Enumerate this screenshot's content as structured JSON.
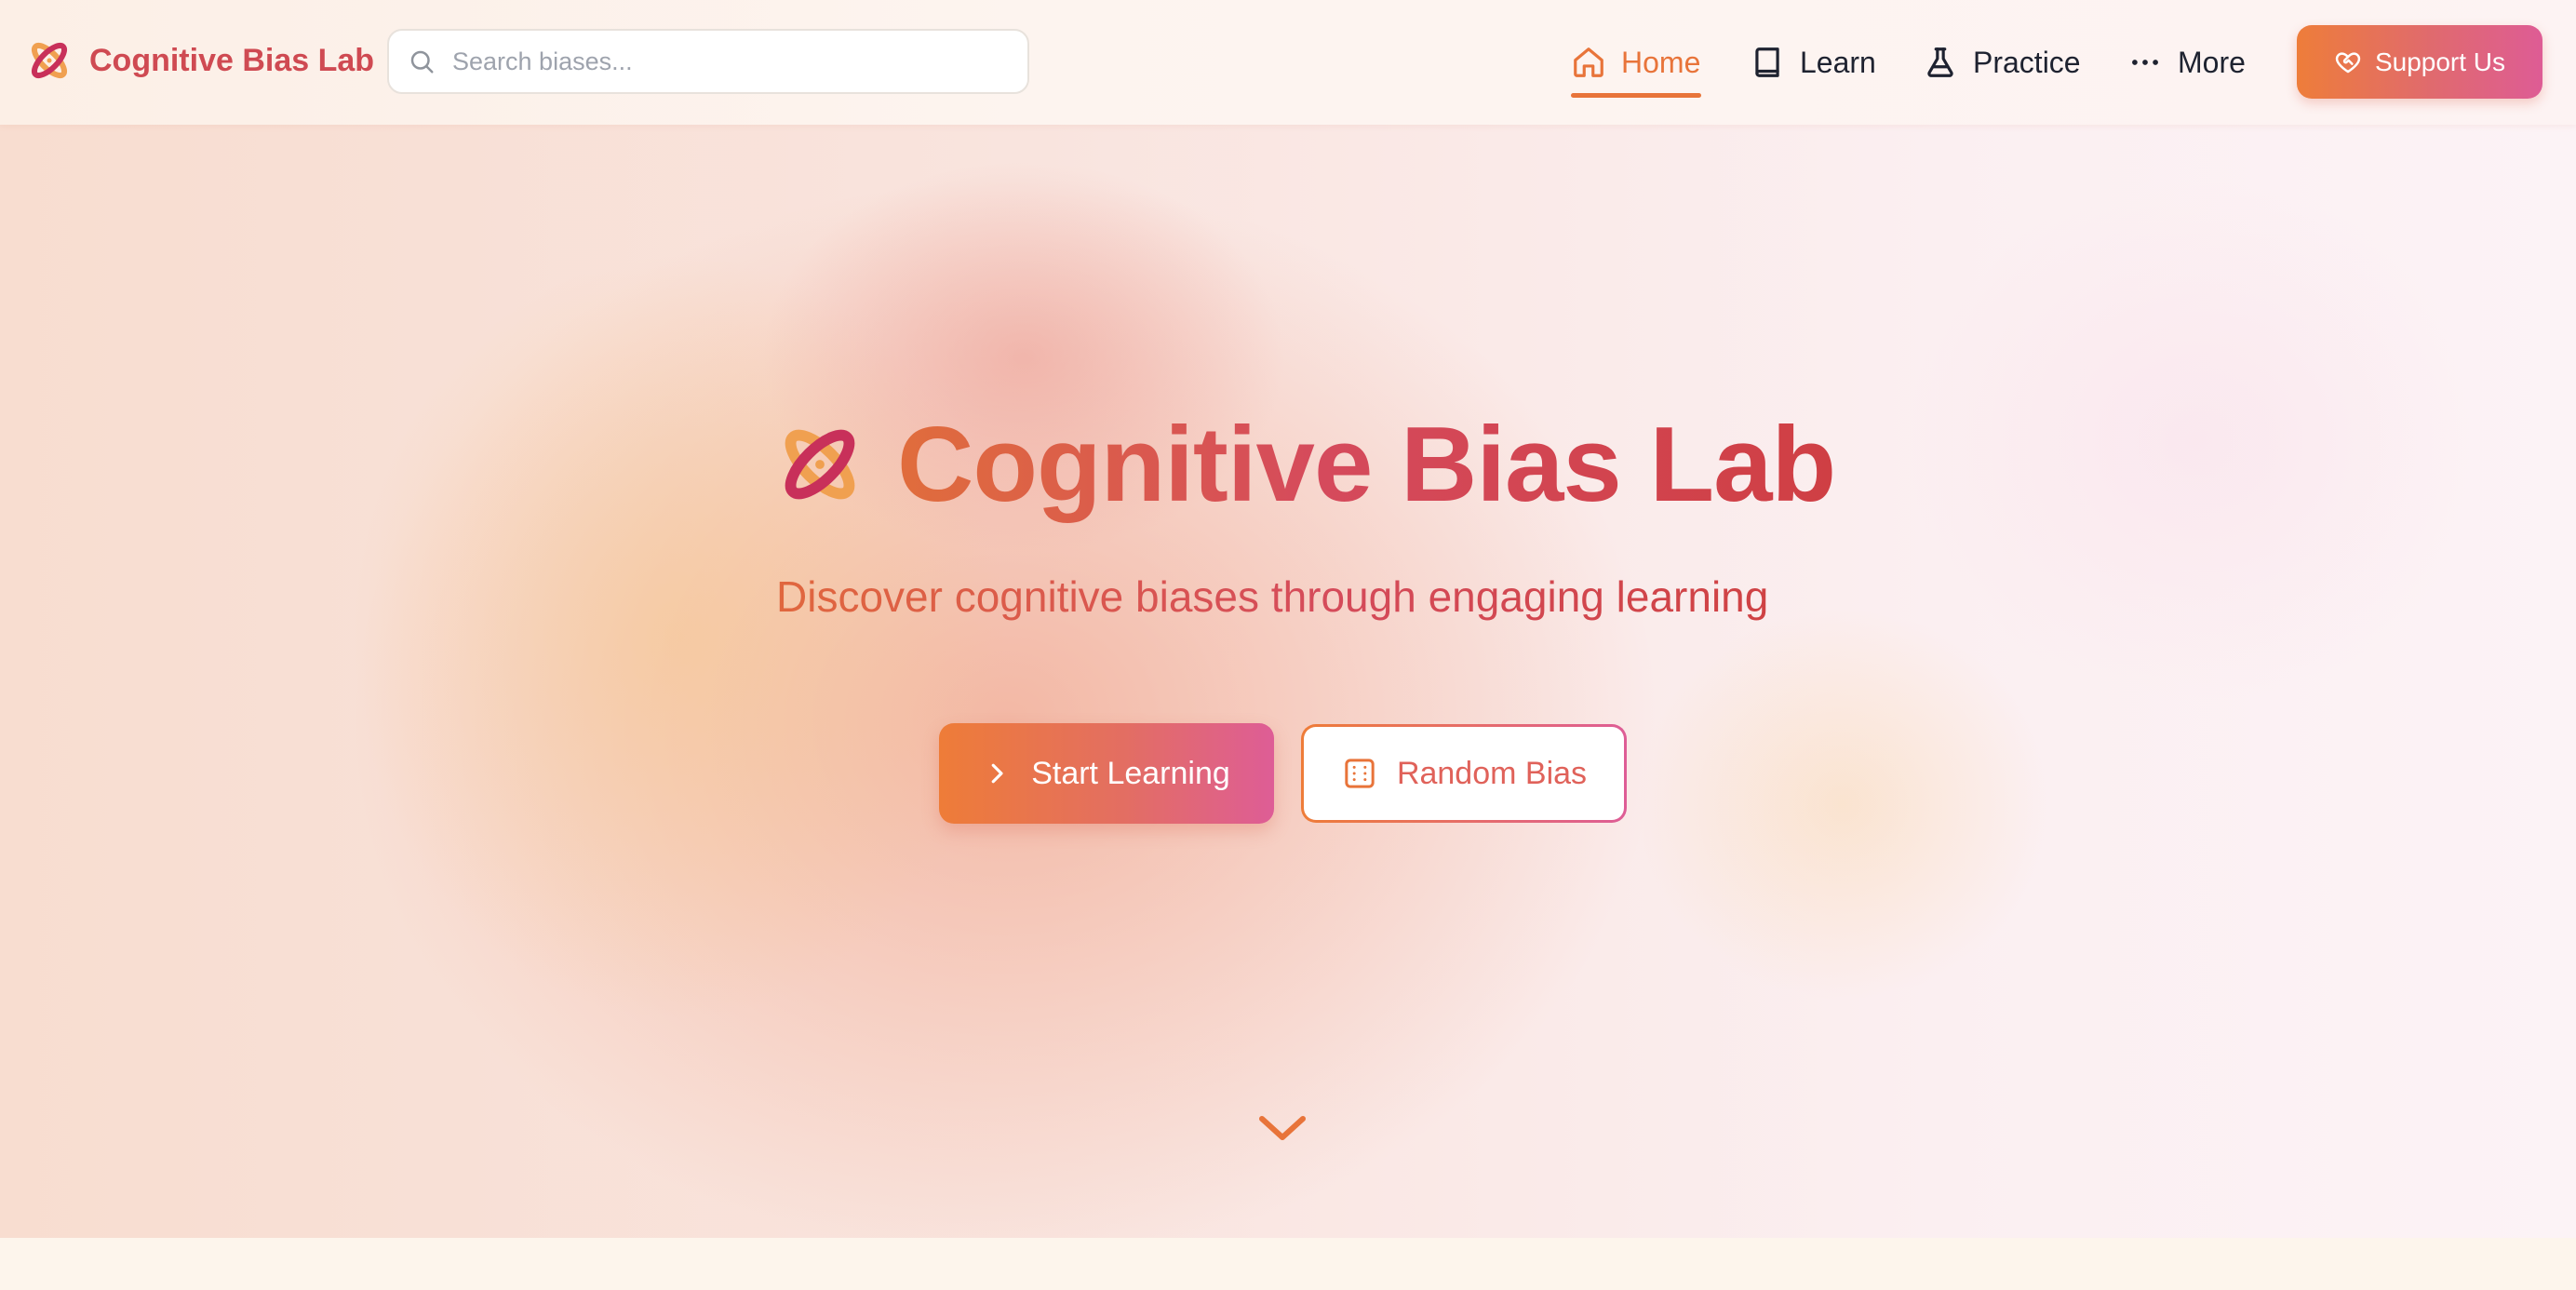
{
  "header": {
    "brand_name": "Cognitive Bias Lab",
    "search_placeholder": "Search biases...",
    "nav": [
      {
        "label": "Home",
        "icon": "home-icon",
        "active": true
      },
      {
        "label": "Learn",
        "icon": "book-icon",
        "active": false
      },
      {
        "label": "Practice",
        "icon": "flask-icon",
        "active": false
      },
      {
        "label": "More",
        "icon": "more-dots-icon",
        "active": false
      }
    ],
    "support_label": "Support Us",
    "support_icon": "heart-handshake-icon"
  },
  "hero": {
    "title": "Cognitive Bias Lab",
    "subtitle": "Discover cognitive biases through engaging learning",
    "primary_button": {
      "label": "Start Learning",
      "icon": "chevron-right-icon"
    },
    "secondary_button": {
      "label": "Random Bias",
      "icon": "dice-icon"
    },
    "scroll_icon": "chevron-down-icon"
  },
  "colors": {
    "accent_orange": "#e8743a",
    "accent_red": "#cf4a52",
    "accent_pink": "#de5c95",
    "logo_orange": "#f0a050",
    "logo_crimson": "#c8305a"
  }
}
